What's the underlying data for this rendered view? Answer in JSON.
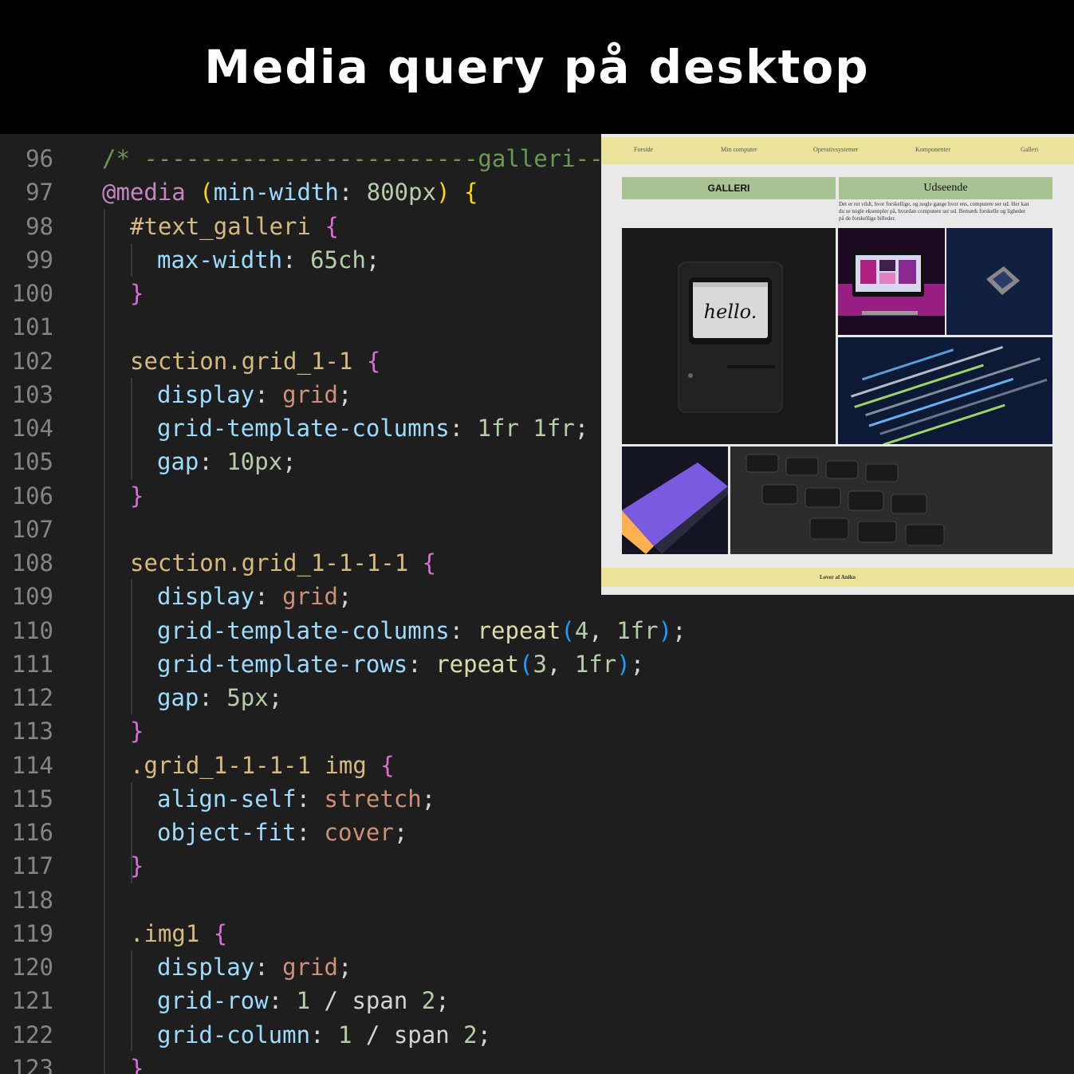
{
  "banner": {
    "title": "Media query på desktop"
  },
  "editor": {
    "lines": [
      {
        "num": "96",
        "indent": 0,
        "tokens": [
          [
            "c-comment",
            "/* ------------------------galleri---"
          ]
        ]
      },
      {
        "num": "97",
        "indent": 0,
        "tokens": [
          [
            "c-at",
            "@media"
          ],
          [
            "c-def",
            " "
          ],
          [
            "c-br1",
            "("
          ],
          [
            "c-prop",
            "min-width"
          ],
          [
            "c-def",
            ": "
          ],
          [
            "c-num",
            "800px"
          ],
          [
            "c-br1",
            ")"
          ],
          [
            "c-def",
            " "
          ],
          [
            "c-br1",
            "{"
          ]
        ]
      },
      {
        "num": "98",
        "indent": 1,
        "tokens": [
          [
            "c-sel",
            "#text_galleri"
          ],
          [
            "c-def",
            " "
          ],
          [
            "c-br2",
            "{"
          ]
        ]
      },
      {
        "num": "99",
        "indent": 2,
        "tokens": [
          [
            "c-prop",
            "max-width"
          ],
          [
            "c-def",
            ": "
          ],
          [
            "c-num",
            "65ch"
          ],
          [
            "c-def",
            ";"
          ]
        ]
      },
      {
        "num": "100",
        "indent": 1,
        "tokens": [
          [
            "c-br2",
            "}"
          ]
        ]
      },
      {
        "num": "101",
        "indent": 0,
        "tokens": []
      },
      {
        "num": "102",
        "indent": 1,
        "tokens": [
          [
            "c-sel",
            "section.grid_1-1"
          ],
          [
            "c-def",
            " "
          ],
          [
            "c-br2",
            "{"
          ]
        ]
      },
      {
        "num": "103",
        "indent": 2,
        "tokens": [
          [
            "c-prop",
            "display"
          ],
          [
            "c-def",
            ": "
          ],
          [
            "c-val",
            "grid"
          ],
          [
            "c-def",
            ";"
          ]
        ]
      },
      {
        "num": "104",
        "indent": 2,
        "tokens": [
          [
            "c-prop",
            "grid-template-columns"
          ],
          [
            "c-def",
            ": "
          ],
          [
            "c-num",
            "1fr 1fr"
          ],
          [
            "c-def",
            ";"
          ]
        ]
      },
      {
        "num": "105",
        "indent": 2,
        "tokens": [
          [
            "c-prop",
            "gap"
          ],
          [
            "c-def",
            ": "
          ],
          [
            "c-num",
            "10px"
          ],
          [
            "c-def",
            ";"
          ]
        ]
      },
      {
        "num": "106",
        "indent": 1,
        "tokens": [
          [
            "c-br2",
            "}"
          ]
        ]
      },
      {
        "num": "107",
        "indent": 0,
        "tokens": []
      },
      {
        "num": "108",
        "indent": 1,
        "tokens": [
          [
            "c-sel",
            "section.grid_1-1-1-1"
          ],
          [
            "c-def",
            " "
          ],
          [
            "c-br2",
            "{"
          ]
        ]
      },
      {
        "num": "109",
        "indent": 2,
        "tokens": [
          [
            "c-prop",
            "display"
          ],
          [
            "c-def",
            ": "
          ],
          [
            "c-val",
            "grid"
          ],
          [
            "c-def",
            ";"
          ]
        ]
      },
      {
        "num": "110",
        "indent": 2,
        "tokens": [
          [
            "c-prop",
            "grid-template-columns"
          ],
          [
            "c-def",
            ": "
          ],
          [
            "c-fn",
            "repeat"
          ],
          [
            "c-br3",
            "("
          ],
          [
            "c-num",
            "4"
          ],
          [
            "c-def",
            ", "
          ],
          [
            "c-num",
            "1fr"
          ],
          [
            "c-br3",
            ")"
          ],
          [
            "c-def",
            ";"
          ]
        ]
      },
      {
        "num": "111",
        "indent": 2,
        "tokens": [
          [
            "c-prop",
            "grid-template-rows"
          ],
          [
            "c-def",
            ": "
          ],
          [
            "c-fn",
            "repeat"
          ],
          [
            "c-br3",
            "("
          ],
          [
            "c-num",
            "3"
          ],
          [
            "c-def",
            ", "
          ],
          [
            "c-num",
            "1fr"
          ],
          [
            "c-br3",
            ")"
          ],
          [
            "c-def",
            ";"
          ]
        ]
      },
      {
        "num": "112",
        "indent": 2,
        "tokens": [
          [
            "c-prop",
            "gap"
          ],
          [
            "c-def",
            ": "
          ],
          [
            "c-num",
            "5px"
          ],
          [
            "c-def",
            ";"
          ]
        ]
      },
      {
        "num": "113",
        "indent": 1,
        "tokens": [
          [
            "c-br2",
            "}"
          ]
        ]
      },
      {
        "num": "114",
        "indent": 1,
        "tokens": [
          [
            "c-sel",
            ".grid_1-1-1-1 img"
          ],
          [
            "c-def",
            " "
          ],
          [
            "c-br2",
            "{"
          ]
        ]
      },
      {
        "num": "115",
        "indent": 2,
        "tokens": [
          [
            "c-prop",
            "align-self"
          ],
          [
            "c-def",
            ": "
          ],
          [
            "c-val",
            "stretch"
          ],
          [
            "c-def",
            ";"
          ]
        ]
      },
      {
        "num": "116",
        "indent": 2,
        "tokens": [
          [
            "c-prop",
            "object-fit"
          ],
          [
            "c-def",
            ": "
          ],
          [
            "c-val",
            "cover"
          ],
          [
            "c-def",
            ";"
          ]
        ]
      },
      {
        "num": "117",
        "indent": 1,
        "tokens": [
          [
            "c-br2",
            "}"
          ]
        ]
      },
      {
        "num": "118",
        "indent": 0,
        "tokens": []
      },
      {
        "num": "119",
        "indent": 1,
        "tokens": [
          [
            "c-sel",
            ".img1"
          ],
          [
            "c-def",
            " "
          ],
          [
            "c-br2",
            "{"
          ]
        ]
      },
      {
        "num": "120",
        "indent": 2,
        "tokens": [
          [
            "c-prop",
            "display"
          ],
          [
            "c-def",
            ": "
          ],
          [
            "c-val",
            "grid"
          ],
          [
            "c-def",
            ";"
          ]
        ]
      },
      {
        "num": "121",
        "indent": 2,
        "tokens": [
          [
            "c-prop",
            "grid-row"
          ],
          [
            "c-def",
            ": "
          ],
          [
            "c-num",
            "1"
          ],
          [
            "c-def",
            " / "
          ],
          [
            "c-def",
            "span "
          ],
          [
            "c-num",
            "2"
          ],
          [
            "c-def",
            ";"
          ]
        ]
      },
      {
        "num": "122",
        "indent": 2,
        "tokens": [
          [
            "c-prop",
            "grid-column"
          ],
          [
            "c-def",
            ": "
          ],
          [
            "c-num",
            "1"
          ],
          [
            "c-def",
            " / "
          ],
          [
            "c-def",
            "span "
          ],
          [
            "c-num",
            "2"
          ],
          [
            "c-def",
            ";"
          ]
        ]
      },
      {
        "num": "123",
        "indent": 1,
        "tokens": [
          [
            "c-br2",
            "}"
          ]
        ]
      }
    ]
  },
  "preview": {
    "nav": [
      "Forside",
      "Min computer",
      "Operativsystemer",
      "Komponenter",
      "Galleri"
    ],
    "gallery_heading": "GALLERI",
    "side_heading": "Udseende",
    "description": "Det er ret vildt, hvor forskellige, og nogle gange hvor ens, computere ser ud. Her kan du se nogle eksempler på, hvordan computere ser ud. Bemærk forskelle og ligheder på de forskellige billeder.",
    "footer": "Lover af Aniko",
    "images": {
      "mac_screen_text": "hello."
    }
  }
}
